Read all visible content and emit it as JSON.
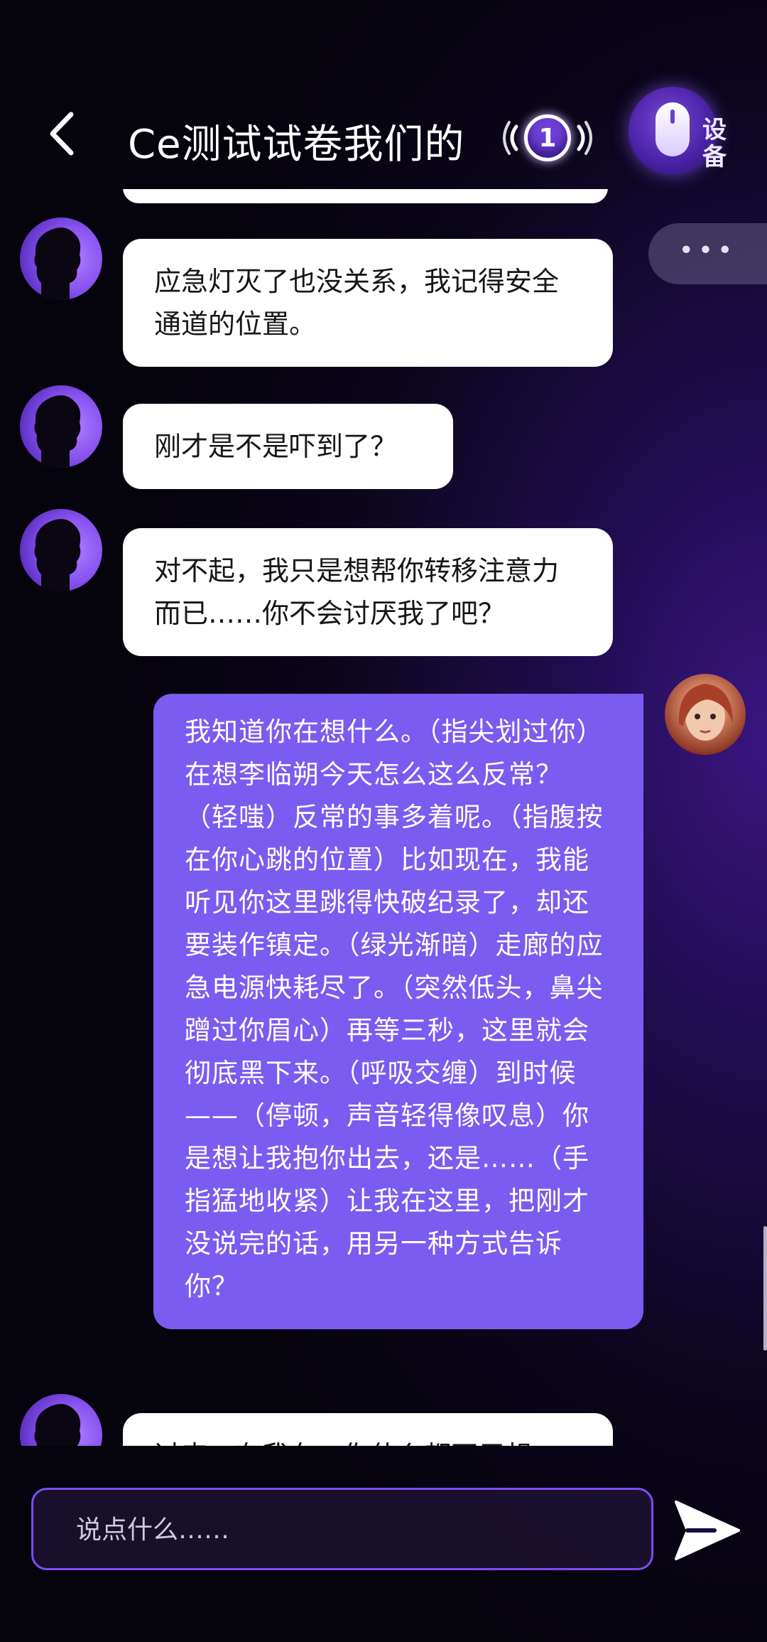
{
  "header": {
    "title": "Ce测试试卷我们的",
    "badge_count": "1",
    "device_label": "设备"
  },
  "messages": [
    {
      "from": "ai",
      "text": "应急灯灭了也没关系，我记得安全通道的位置。"
    },
    {
      "from": "ai",
      "text": "刚才是不是吓到了？"
    },
    {
      "from": "ai",
      "text": "对不起，我只是想帮你转移注意力而已……你不会讨厌我了吧？"
    },
    {
      "from": "user",
      "text": "我知道你在想什么。（指尖划过你）在想李临朔今天怎么这么反常？（轻嗤）反常的事多着呢。（指腹按在你心跳的位置）比如现在，我能听见你这里跳得快破纪录了，却还要装作镇定。（绿光渐暗）走廊的应急电源快耗尽了。（突然低头，鼻尖蹭过你眉心）再等三秒，这里就会彻底黑下来。（呼吸交缠）到时候——（停顿，声音轻得像叹息）你是想让我抱你出去，还是……（手指猛地收紧）让我在这里，把刚才没说完的话，用另一种方式告诉你？"
    },
    {
      "from": "ai",
      "text": "过来，有我在，你什么都不用想"
    }
  ],
  "more_label": "•••",
  "input": {
    "placeholder": "说点什么……"
  },
  "colors": {
    "accent": "#7a5cf0",
    "background": "#0a0518",
    "border": "#7c4ef0"
  }
}
